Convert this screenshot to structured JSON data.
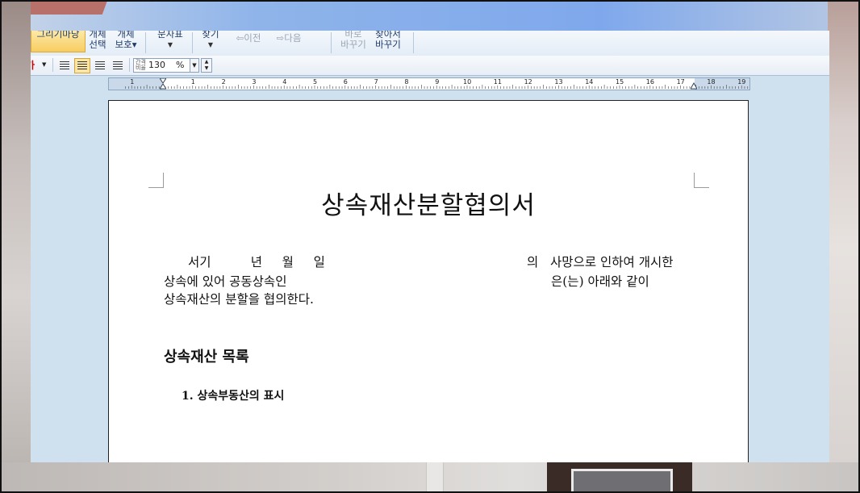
{
  "ribbon": {
    "drawing_mode": "그리기마당",
    "select_object": [
      "개체",
      "선택"
    ],
    "protect_object": [
      "개체",
      "보호▾"
    ],
    "layout": "문자표",
    "find": "찾기",
    "prev": "이전",
    "next": "다음",
    "replace": [
      "바로",
      "바꾸기"
    ],
    "find_replace": [
      "찾아서",
      "바꾸기"
    ]
  },
  "toolbar": {
    "font_color_label": "가",
    "zoom_value": "130",
    "zoom_unit": "%",
    "zoom_icon_text": "간격\n비율"
  },
  "ruler": {
    "labels": [
      "1",
      "1",
      "2",
      "3",
      "4",
      "5",
      "6",
      "7",
      "8",
      "9",
      "10",
      "11",
      "12",
      "13",
      "14",
      "15",
      "16",
      "17",
      "18",
      "19"
    ]
  },
  "document": {
    "title": "상속재산분할협의서",
    "line1_left": "서기          년     월     일",
    "line1_right": "의   사망으로 인하여 개시한",
    "line2_left": "상속에 있어 공동상속인",
    "line2_right": "은(는) 아래와 같이",
    "line3": "상속재산의 분할을 협의한다.",
    "section_heading": "상속재산  목록",
    "subsection": "1.  상속부동산의  표시"
  }
}
